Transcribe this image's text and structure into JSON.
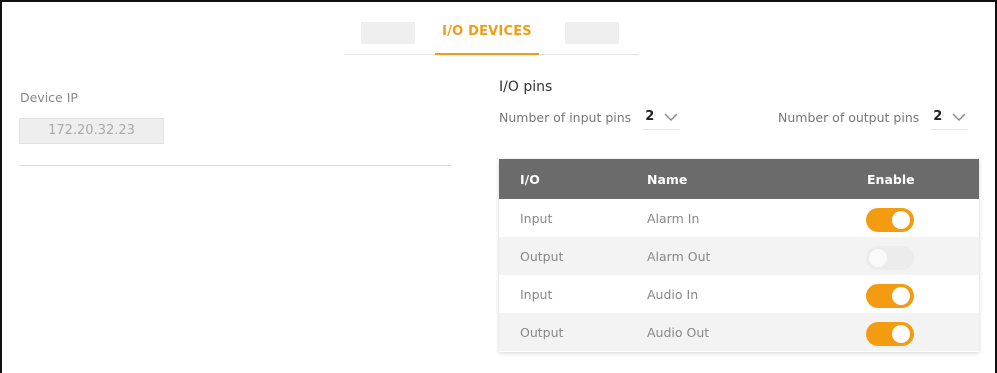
{
  "tabs": {
    "active_label": "I/O DEVICES"
  },
  "device": {
    "ip_label": "Device IP",
    "ip_value": "172.20.32.23"
  },
  "pins": {
    "title": "I/O pins",
    "input_label": "Number of input pins",
    "input_value": "2",
    "output_label": "Number of output pins",
    "output_value": "2"
  },
  "table": {
    "headers": {
      "io": "I/O",
      "name": "Name",
      "enable": "Enable"
    },
    "rows": [
      {
        "io": "Input",
        "name": "Alarm In",
        "enabled": true
      },
      {
        "io": "Output",
        "name": "Alarm Out",
        "enabled": false
      },
      {
        "io": "Input",
        "name": "Audio In",
        "enabled": true
      },
      {
        "io": "Output",
        "name": "Audio Out",
        "enabled": true
      }
    ]
  },
  "colors": {
    "accent": "#f39c12",
    "table_header": "#6b6b6b"
  }
}
